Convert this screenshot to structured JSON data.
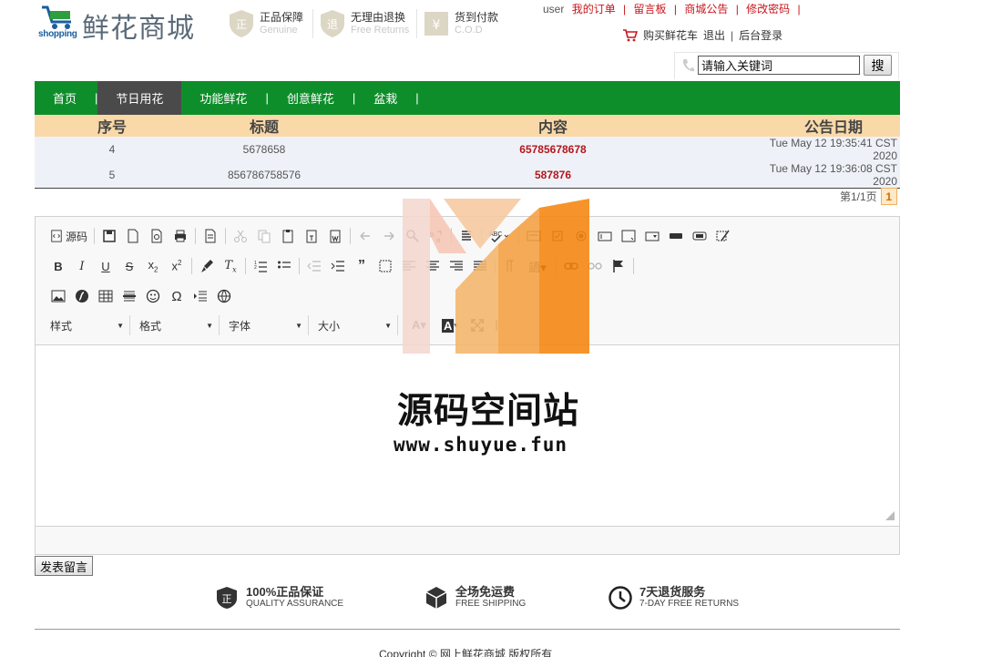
{
  "brand": {
    "small": "shopping",
    "name": "鲜花商城"
  },
  "badges": [
    {
      "title": "正品保障",
      "sub": "Genuine"
    },
    {
      "title": "无理由退换",
      "sub": "Free Returns"
    },
    {
      "title": "货到付款",
      "sub": "C.O.D"
    }
  ],
  "toplinks": {
    "user": "user",
    "orders": "我的订单",
    "board": "留言板",
    "notice": "商城公告",
    "password": "修改密码",
    "cart": "购买鲜花车",
    "logout": "退出",
    "admin": "后台登录"
  },
  "search": {
    "value": "请输入关键词",
    "button": "搜"
  },
  "nav": [
    "首页",
    "节日用花",
    "功能鲜花",
    "创意鲜花",
    "盆栽"
  ],
  "table": {
    "headers": [
      "序号",
      "标题",
      "内容",
      "公告日期"
    ],
    "rows": [
      {
        "id": "4",
        "title": "5678658",
        "content": "65785678678",
        "date": "Tue May 12 19:35:41 CST 2020"
      },
      {
        "id": "5",
        "title": "856786758576",
        "content": "587876",
        "date": "Tue May 12 19:36:08 CST 2020"
      }
    ]
  },
  "pager": {
    "text": "第1/1页",
    "current": "1"
  },
  "editor": {
    "source_label": "源码",
    "combos": [
      "样式",
      "格式",
      "字体",
      "大小"
    ]
  },
  "submit_label": "发表留言",
  "features": [
    {
      "title": "100%正品保证",
      "sub": "QUALITY ASSURANCE"
    },
    {
      "title": "全场免运费",
      "sub": "FREE SHIPPING"
    },
    {
      "title": "7天退货服务",
      "sub": "7-DAY FREE RETURNS"
    }
  ],
  "copyright": "Copyright © 网上鲜花商城 版权所有",
  "watermark": {
    "text": "源码空间站",
    "url": "www.shuyue.fun"
  },
  "colors": {
    "nav": "#0e8e2a",
    "nav_active": "#4a4a4a",
    "table_head": "#fad9a8",
    "accent_red": "#c8161d"
  }
}
